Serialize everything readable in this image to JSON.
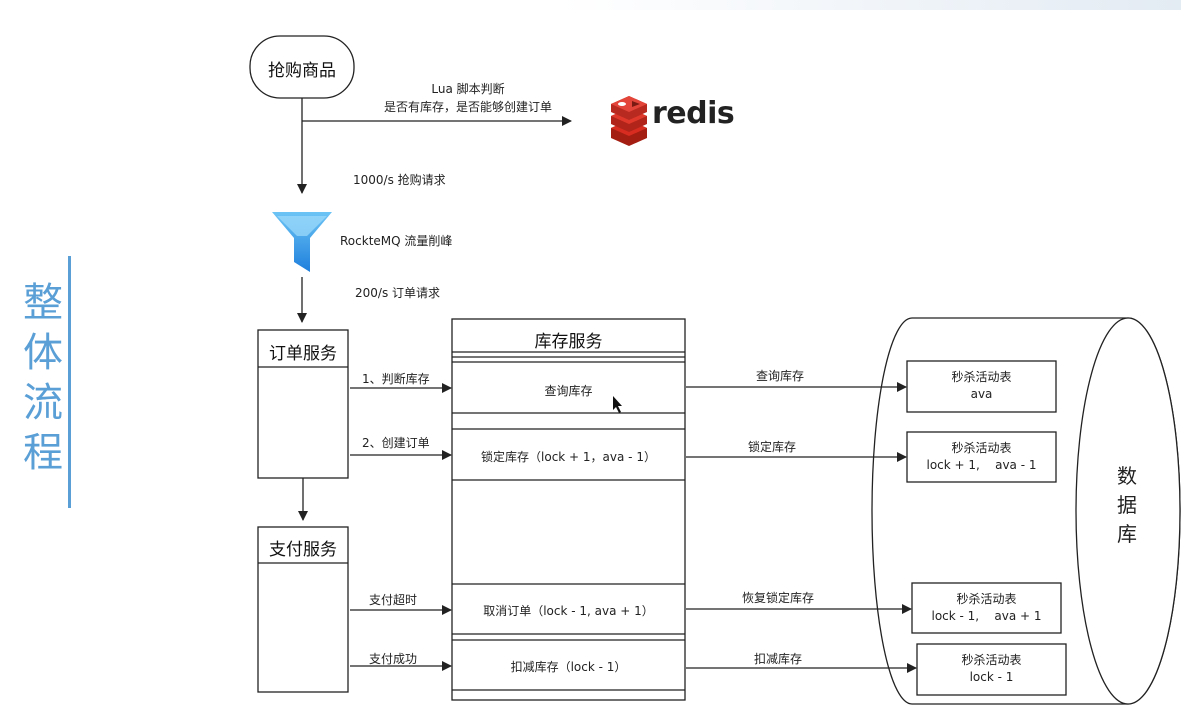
{
  "side_title": [
    "整",
    "体",
    "流",
    "程"
  ],
  "start_node": "抢购商品",
  "lua_label": [
    "Lua 脚本判断",
    "是否有库存，是否能够创建订单"
  ],
  "redis_label": "redis",
  "rate_1000": "1000/s 抢购请求",
  "mq_label": "RockteMQ  流量削峰",
  "rate_200": "200/s 订单请求",
  "order_service": "订单服务",
  "pay_service": "支付服务",
  "inventory_service": "库存服务",
  "step1": "1、判断库存",
  "step2": "2、创建订单",
  "pay_timeout": "支付超时",
  "pay_success": "支付成功",
  "inv_rows": [
    "查询库存",
    "锁定库存（lock + 1，ava - 1）",
    "取消订单（lock - 1,   ava + 1）",
    "扣减库存（lock - 1）"
  ],
  "db_arrows": [
    "查询库存",
    "锁定库存",
    "恢复锁定库存",
    "扣减库存"
  ],
  "tables": [
    {
      "name": "秒杀活动表",
      "value": "ava"
    },
    {
      "name": "秒杀活动表",
      "value": "lock + 1,    ava - 1"
    },
    {
      "name": "秒杀活动表",
      "value": "lock - 1,    ava + 1"
    },
    {
      "name": "秒杀活动表",
      "value": "lock - 1"
    }
  ],
  "db_label": [
    "数",
    "据",
    "库"
  ],
  "colors": {
    "accent": "#5a9fd6",
    "funnel": "#2b8fe0",
    "redis": "#c6302b"
  }
}
